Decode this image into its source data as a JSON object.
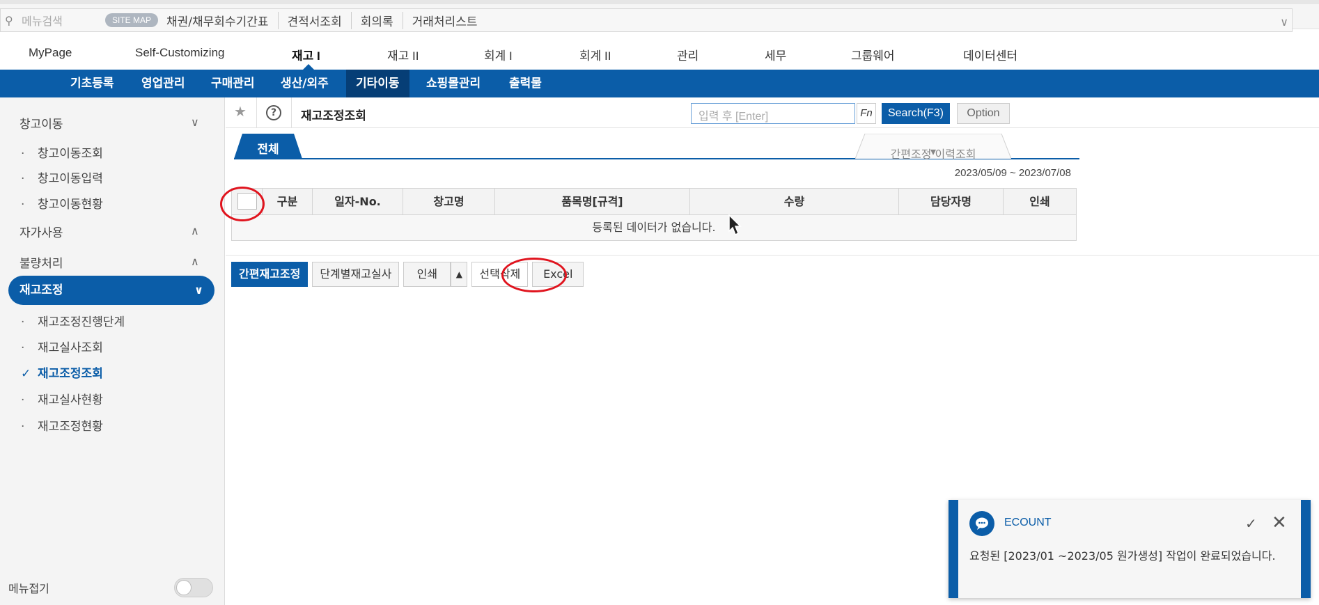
{
  "topbar": {
    "search_placeholder": "메뉴검색",
    "sitemap": "SITE MAP",
    "quick_links": [
      "채권/채무회수기간표",
      "견적서조회",
      "회의록",
      "거래처리스트"
    ]
  },
  "mainnav": {
    "items": [
      "MyPage",
      "Self-Customizing",
      "재고 I",
      "재고 II",
      "회계 I",
      "회계 II",
      "관리",
      "세무",
      "그룹웨어",
      "데이터센터"
    ],
    "active": "재고 I"
  },
  "subnav": {
    "items": [
      "기초등록",
      "영업관리",
      "구매관리",
      "생산/외주",
      "기타이동",
      "쇼핑몰관리",
      "출력물"
    ],
    "active": "기타이동"
  },
  "sidebar": {
    "groups": {
      "warehouse_move": "창고이동",
      "self_use": "자가사용",
      "defect": "불량처리",
      "stock_adjust": "재고조정"
    },
    "warehouse_items": [
      "창고이동조회",
      "창고이동입력",
      "창고이동현황"
    ],
    "adjust_items": [
      "재고조정진행단계",
      "재고실사조회",
      "재고조정조회",
      "재고실사현황",
      "재고조정현황"
    ],
    "current": "재고조정조회",
    "collapse_label": "메뉴접기"
  },
  "toolbar": {
    "page_title": "재고조정조회",
    "search_placeholder": "입력 후 [Enter]",
    "fn_label": "Fn",
    "search_button": "Search(F3)",
    "option_button": "Option"
  },
  "tabs": {
    "all": "전체",
    "history": "간편조정 이력조회"
  },
  "date_range": "2023/05/09 ~ 2023/07/08",
  "grid": {
    "columns": [
      "구분",
      "일자-No.",
      "창고명",
      "품목명[규격]",
      "수량",
      "담당자명",
      "인쇄"
    ],
    "empty_message": "등록된 데이터가 없습니다."
  },
  "actions": {
    "simple_adjust": "간편재고조정",
    "stage_audit": "단계별재고실사",
    "print": "인쇄",
    "delete_selected": "선택삭제",
    "excel": "Excel"
  },
  "toast": {
    "title": "ECOUNT",
    "message": "요청된 [2023/01 ~2023/05 원가생성] 작업이 완료되었습니다."
  },
  "colors": {
    "brand_blue": "#0b5da8",
    "annotation_red": "#e0141e"
  }
}
